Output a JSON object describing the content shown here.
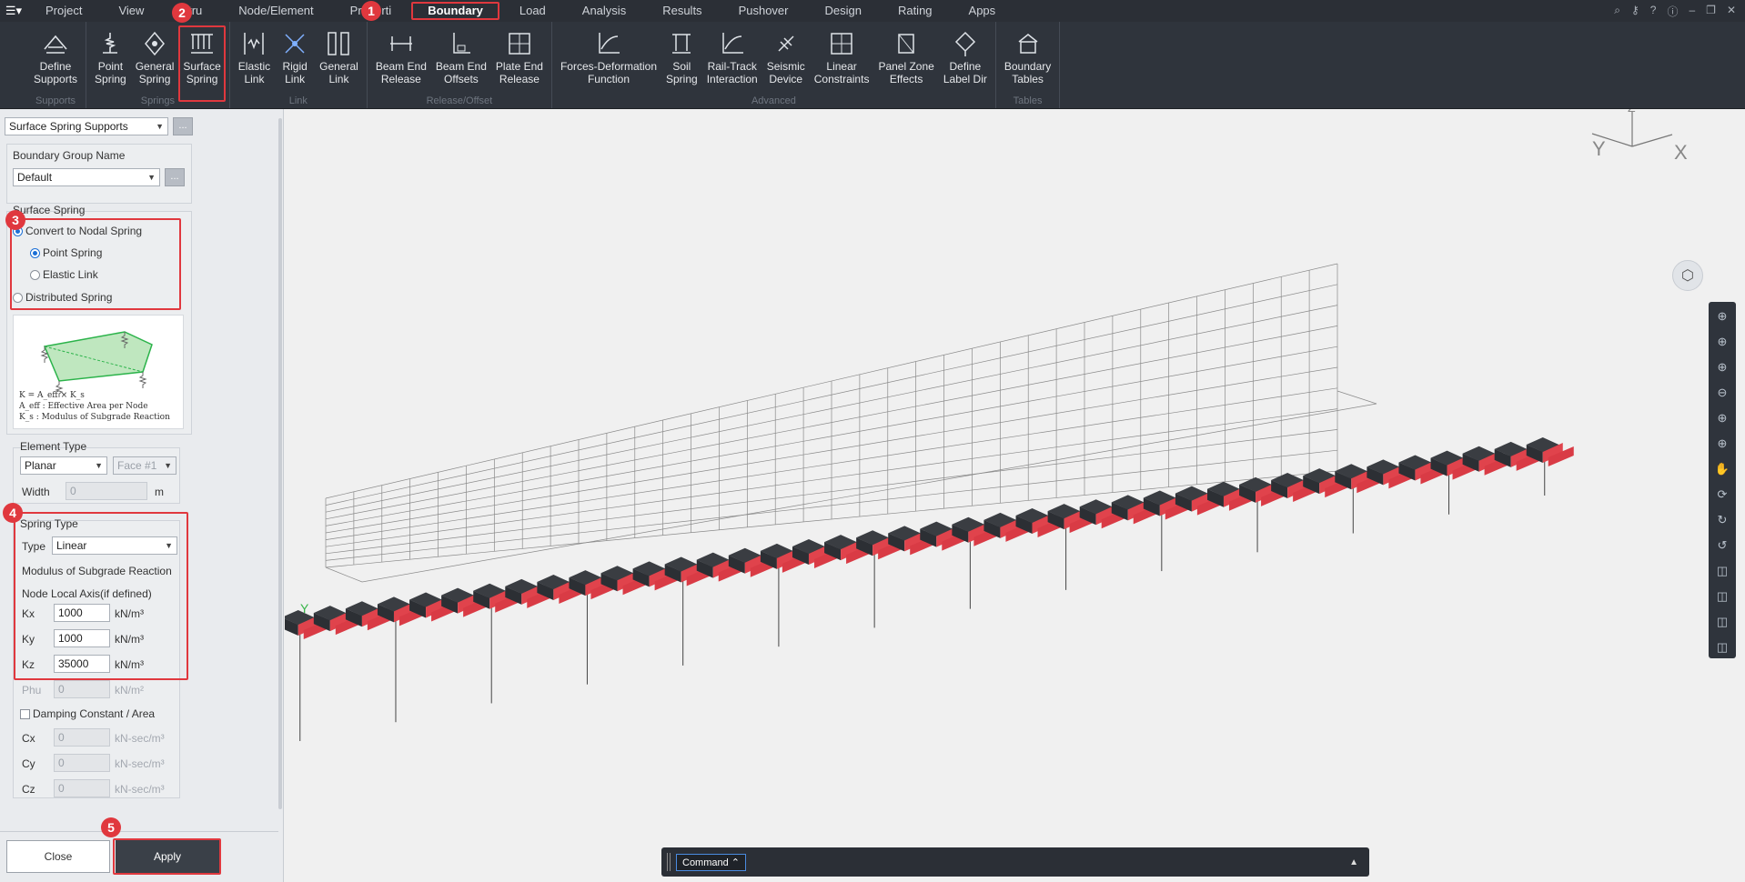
{
  "menubar": {
    "items": [
      "Project",
      "View",
      "Stru",
      "Node/Element",
      "Properti",
      "Boundary",
      "Load",
      "Analysis",
      "Results",
      "Pushover",
      "Design",
      "Rating",
      "Apps"
    ],
    "active": "Boundary"
  },
  "ribbon": {
    "groups": [
      {
        "label": "Supports",
        "buttons": [
          {
            "label": "Define\nSupports",
            "icon": "define-supports-icon"
          }
        ]
      },
      {
        "label": "Springs",
        "buttons": [
          {
            "label": "Point\nSpring",
            "icon": "point-spring-icon"
          },
          {
            "label": "General\nSpring",
            "icon": "general-spring-icon"
          },
          {
            "label": "Surface\nSpring",
            "icon": "surface-spring-icon",
            "highlight": true
          }
        ]
      },
      {
        "label": "Link",
        "buttons": [
          {
            "label": "Elastic\nLink",
            "icon": "elastic-link-icon"
          },
          {
            "label": "Rigid\nLink",
            "icon": "rigid-link-icon"
          },
          {
            "label": "General\nLink",
            "icon": "general-link-icon"
          }
        ]
      },
      {
        "label": "Release/Offset",
        "buttons": [
          {
            "label": "Beam End\nRelease",
            "icon": "beam-end-release-icon"
          },
          {
            "label": "Beam End\nOffsets",
            "icon": "beam-end-offsets-icon"
          },
          {
            "label": "Plate End\nRelease",
            "icon": "plate-end-release-icon"
          }
        ]
      },
      {
        "label": "Advanced",
        "buttons": [
          {
            "label": "Forces-Deformation\nFunction",
            "icon": "forces-deformation-icon"
          },
          {
            "label": "Soil\nSpring",
            "icon": "soil-spring-icon"
          },
          {
            "label": "Rail-Track\nInteraction",
            "icon": "rail-track-icon"
          },
          {
            "label": "Seismic\nDevice",
            "icon": "seismic-device-icon"
          },
          {
            "label": "Linear\nConstraints",
            "icon": "linear-constraints-icon"
          },
          {
            "label": "Panel Zone\nEffects",
            "icon": "panel-zone-icon"
          },
          {
            "label": "Define\nLabel Dir",
            "icon": "define-label-dir-icon"
          }
        ]
      },
      {
        "label": "Tables",
        "buttons": [
          {
            "label": "Boundary\nTables",
            "icon": "boundary-tables-icon"
          }
        ]
      }
    ]
  },
  "panel": {
    "mode_select": "Surface Spring Supports",
    "group_name_label": "Boundary Group Name",
    "group_name_value": "Default",
    "surface_spring_title": "Surface Spring",
    "convert_label": "Convert to Nodal Spring",
    "point_spring_label": "Point Spring",
    "elastic_link_label": "Elastic Link",
    "distributed_label": "Distributed Spring",
    "diagram_formula": "K = A_eff × K_s",
    "diagram_line1": "A_eff : Effective Area per Node",
    "diagram_line2": "K_s : Modulus of Subgrade Reaction",
    "element_type_title": "Element Type",
    "element_type_value": "Planar",
    "face_value": "Face #1",
    "width_label": "Width",
    "width_value": "0",
    "width_unit": "m",
    "spring_type_title": "Spring Type",
    "type_label": "Type",
    "type_value": "Linear",
    "modulus_label": "Modulus of Subgrade Reaction",
    "local_axis_label": "Node Local Axis(if defined)",
    "kx_label": "Kx",
    "kx_value": "1000",
    "kx_unit": "kN/m³",
    "ky_label": "Ky",
    "ky_value": "1000",
    "ky_unit": "kN/m³",
    "kz_label": "Kz",
    "kz_value": "35000",
    "kz_unit": "kN/m³",
    "phu_label": "Phu",
    "phu_value": "0",
    "phu_unit": "kN/m²",
    "damping_label": "Damping Constant / Area",
    "cx_label": "Cx",
    "cx_value": "0",
    "cx_unit": "kN-sec/m³",
    "cy_label": "Cy",
    "cy_value": "0",
    "cy_unit": "kN-sec/m³",
    "cz_label": "Cz",
    "cz_value": "0",
    "cz_unit": "kN-sec/m³",
    "close_label": "Close",
    "apply_label": "Apply"
  },
  "badges": [
    "1",
    "2",
    "3",
    "4",
    "5"
  ],
  "viewport": {
    "axis_x": "X",
    "axis_y": "Y",
    "axis_z": "Z",
    "model_axis_y": "Y",
    "command_label": "Command"
  },
  "colors": {
    "accent_red": "#e0383e",
    "spring_block": "#e0434c",
    "ribbon_bg": "#2f343c"
  }
}
